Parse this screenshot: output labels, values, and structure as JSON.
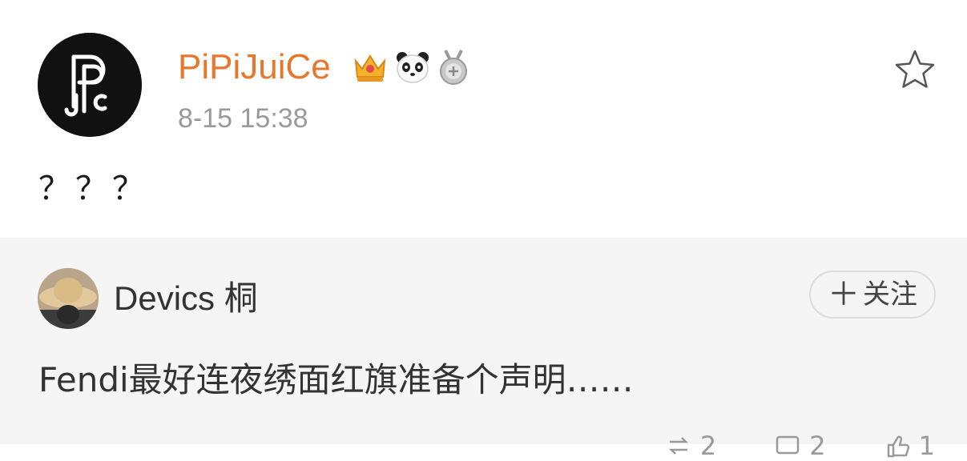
{
  "post": {
    "username": "PiPiJuiCe",
    "timestamp": "8-15 15:38",
    "text": "？？？",
    "badges": [
      "crown-icon",
      "panda-icon",
      "medal-icon"
    ],
    "favorite_icon": "star-icon",
    "username_color": "#e8772e"
  },
  "repost": {
    "username": "Devics 桐",
    "follow_label": "关注",
    "follow_icon": "plus-icon",
    "text": "Fendi最好连夜绣面红旗准备个声明……",
    "actions": [
      {
        "icon": "repost-icon",
        "count": "2"
      },
      {
        "icon": "comment-icon",
        "count": "2"
      },
      {
        "icon": "like-icon",
        "count": "1"
      }
    ]
  }
}
